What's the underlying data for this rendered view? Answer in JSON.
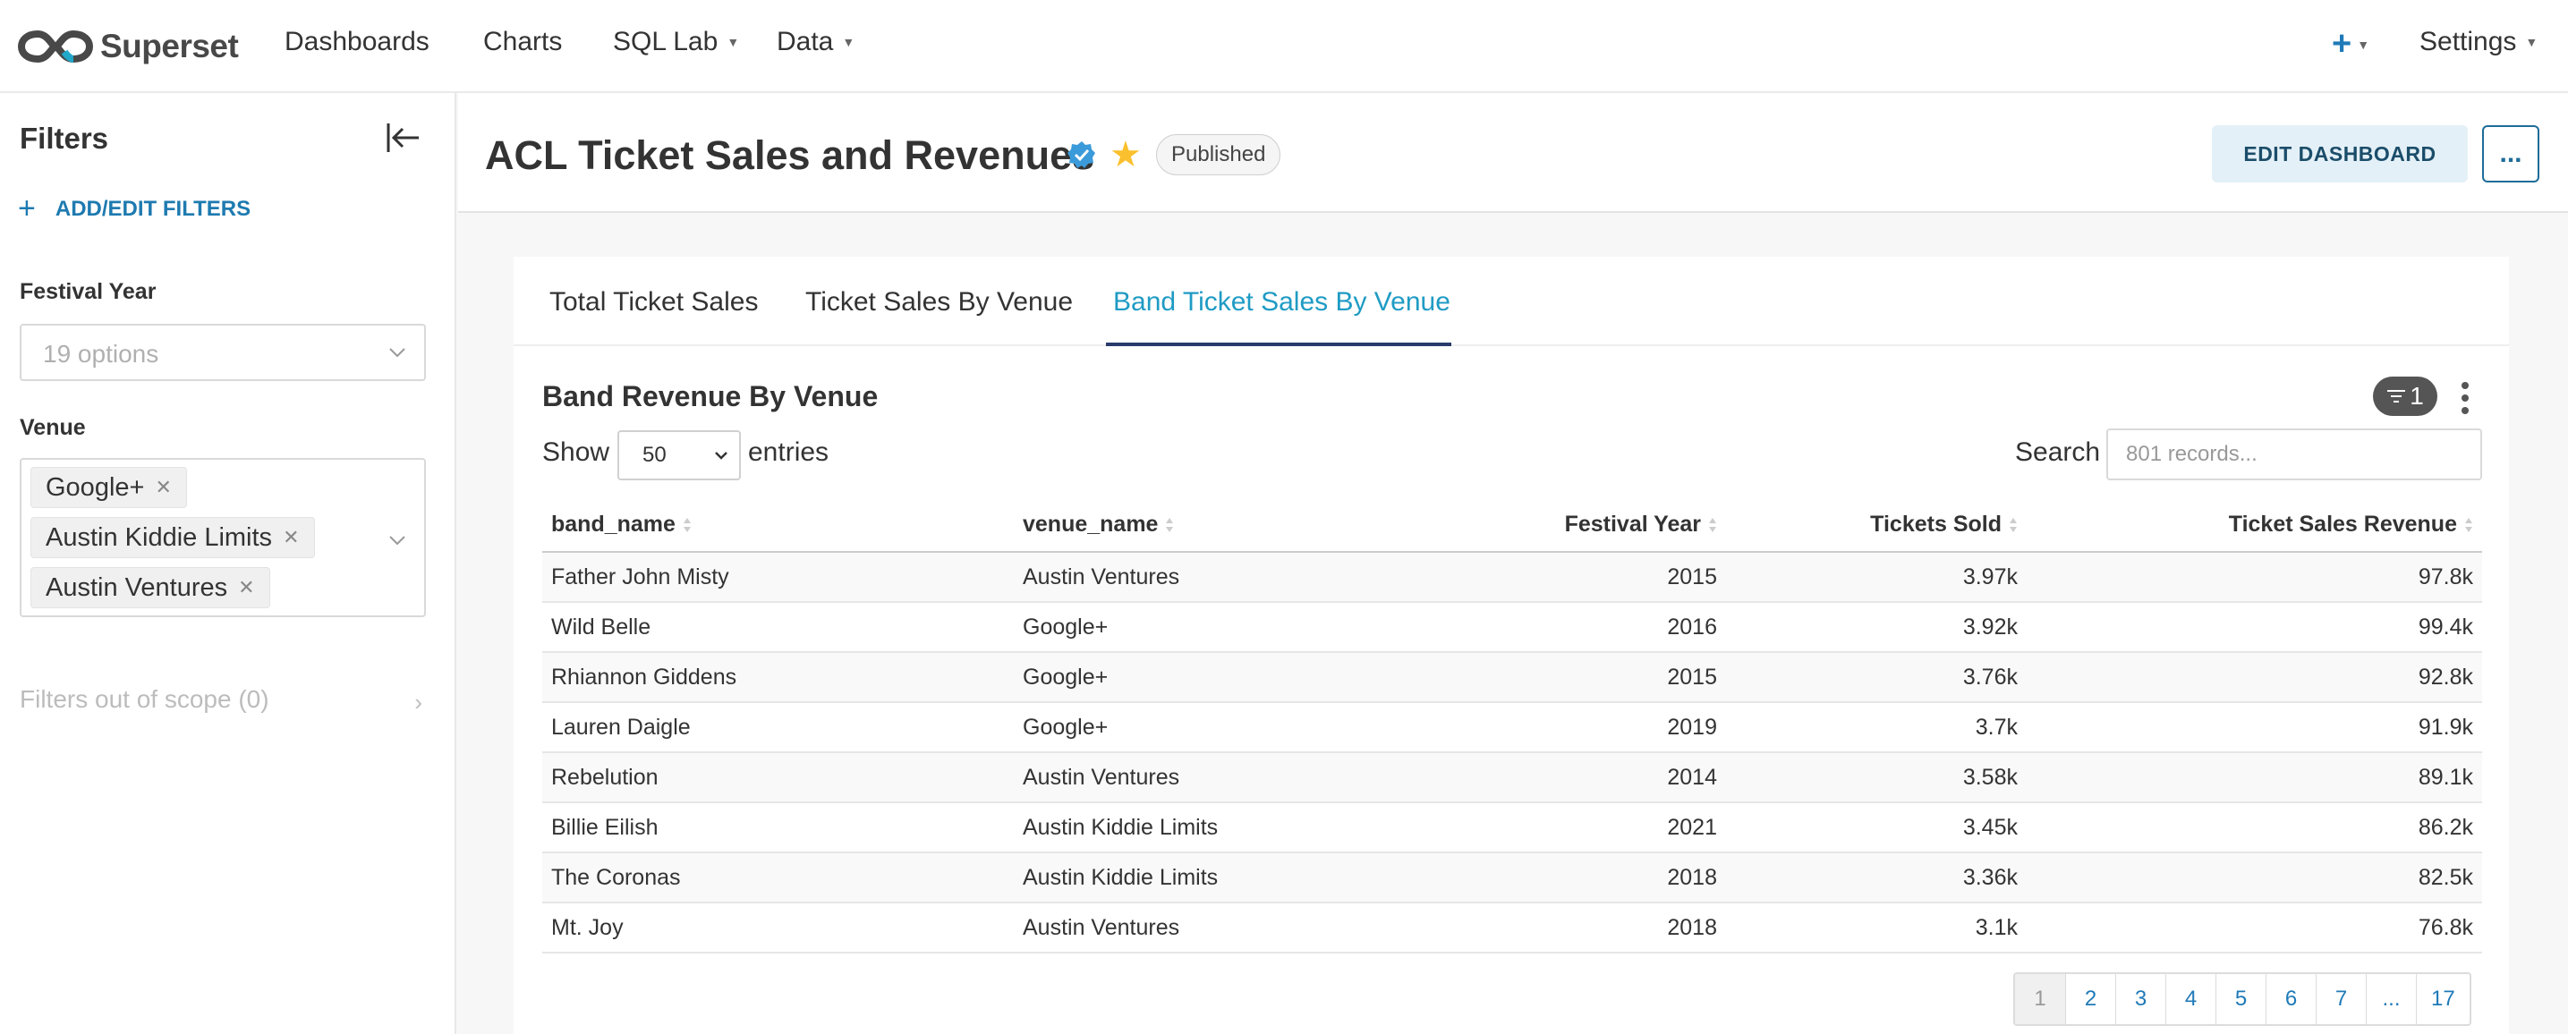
{
  "nav": {
    "brand": "Superset",
    "items": [
      {
        "label": "Dashboards"
      },
      {
        "label": "Charts"
      },
      {
        "label": "SQL Lab"
      },
      {
        "label": "Data"
      }
    ],
    "settings_label": "Settings",
    "plus_icon": "plus-icon"
  },
  "sidebar": {
    "title": "Filters",
    "add_filters_label": "ADD/EDIT FILTERS",
    "festival_year": {
      "label": "Festival Year",
      "placeholder": "19 options"
    },
    "venue": {
      "label": "Venue",
      "tags": [
        "Google+",
        "Austin Kiddie Limits",
        "Austin Ventures"
      ]
    },
    "out_of_scope": "Filters out of scope (0)"
  },
  "header": {
    "title": "ACL Ticket Sales and Revenues",
    "status": "Published",
    "edit_label": "EDIT DASHBOARD",
    "more_label": "..."
  },
  "tabs": [
    {
      "label": "Total Ticket Sales"
    },
    {
      "label": "Ticket Sales By Venue"
    },
    {
      "label": "Band Ticket Sales By Venue"
    }
  ],
  "chart": {
    "title": "Band Revenue By Venue",
    "filter_count": "1",
    "show_label": "Show",
    "entries_value": "50",
    "entries_label": "entries",
    "search_label": "Search",
    "search_placeholder": "801 records...",
    "columns": [
      "band_name",
      "venue_name",
      "Festival Year",
      "Tickets Sold",
      "Ticket Sales Revenue"
    ],
    "rows": [
      [
        "Father John Misty",
        "Austin Ventures",
        "2015",
        "3.97k",
        "97.8k"
      ],
      [
        "Wild Belle",
        "Google+",
        "2016",
        "3.92k",
        "99.4k"
      ],
      [
        "Rhiannon Giddens",
        "Google+",
        "2015",
        "3.76k",
        "92.8k"
      ],
      [
        "Lauren Daigle",
        "Google+",
        "2019",
        "3.7k",
        "91.9k"
      ],
      [
        "Rebelution",
        "Austin Ventures",
        "2014",
        "3.58k",
        "89.1k"
      ],
      [
        "Billie Eilish",
        "Austin Kiddie Limits",
        "2021",
        "3.45k",
        "86.2k"
      ],
      [
        "The Coronas",
        "Austin Kiddie Limits",
        "2018",
        "3.36k",
        "82.5k"
      ],
      [
        "Mt. Joy",
        "Austin Ventures",
        "2018",
        "3.1k",
        "76.8k"
      ]
    ],
    "pages": [
      "1",
      "2",
      "3",
      "4",
      "5",
      "6",
      "7",
      "...",
      "17"
    ]
  },
  "colors": {
    "accent": "#1f9bc4",
    "link": "#1f7ab8",
    "star": "#fbc02d",
    "tab_underline": "#293a6b"
  }
}
